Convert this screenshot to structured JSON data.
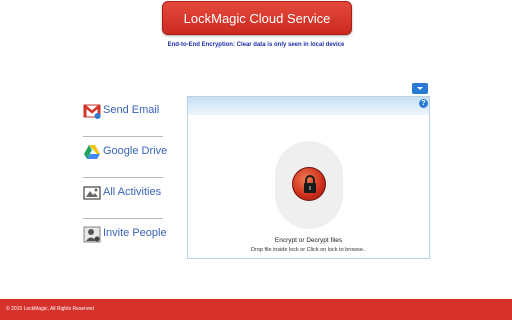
{
  "header": {
    "title": "LockMagic Cloud Service",
    "subtitle": "End-to-End Encryption: Clear data is only seen in local device"
  },
  "sidebar": {
    "items": [
      {
        "label": "Send Email",
        "icon": "gmail-icon"
      },
      {
        "label": "Google Drive",
        "icon": "google-drive-icon"
      },
      {
        "label": "All Activities",
        "icon": "activities-icon"
      },
      {
        "label": "Invite People",
        "icon": "invite-person-icon"
      }
    ]
  },
  "panel": {
    "menu_icon": "chevron-down-icon",
    "help_icon": "help-icon",
    "help_glyph": "?",
    "lock_icon": "lock-icon",
    "drop_title": "Encrypt or Decrypt files",
    "drop_hint": "Drop file inside lock or Click on lock to browse.."
  },
  "footer": {
    "copyright": "© 2015 LockMagic, All Rights Reserved"
  },
  "colors": {
    "brand_red": "#d6312a",
    "link_blue": "#3a63b8",
    "subtitle_blue": "#1c2fa8",
    "accent_blue": "#2a7bd6"
  }
}
